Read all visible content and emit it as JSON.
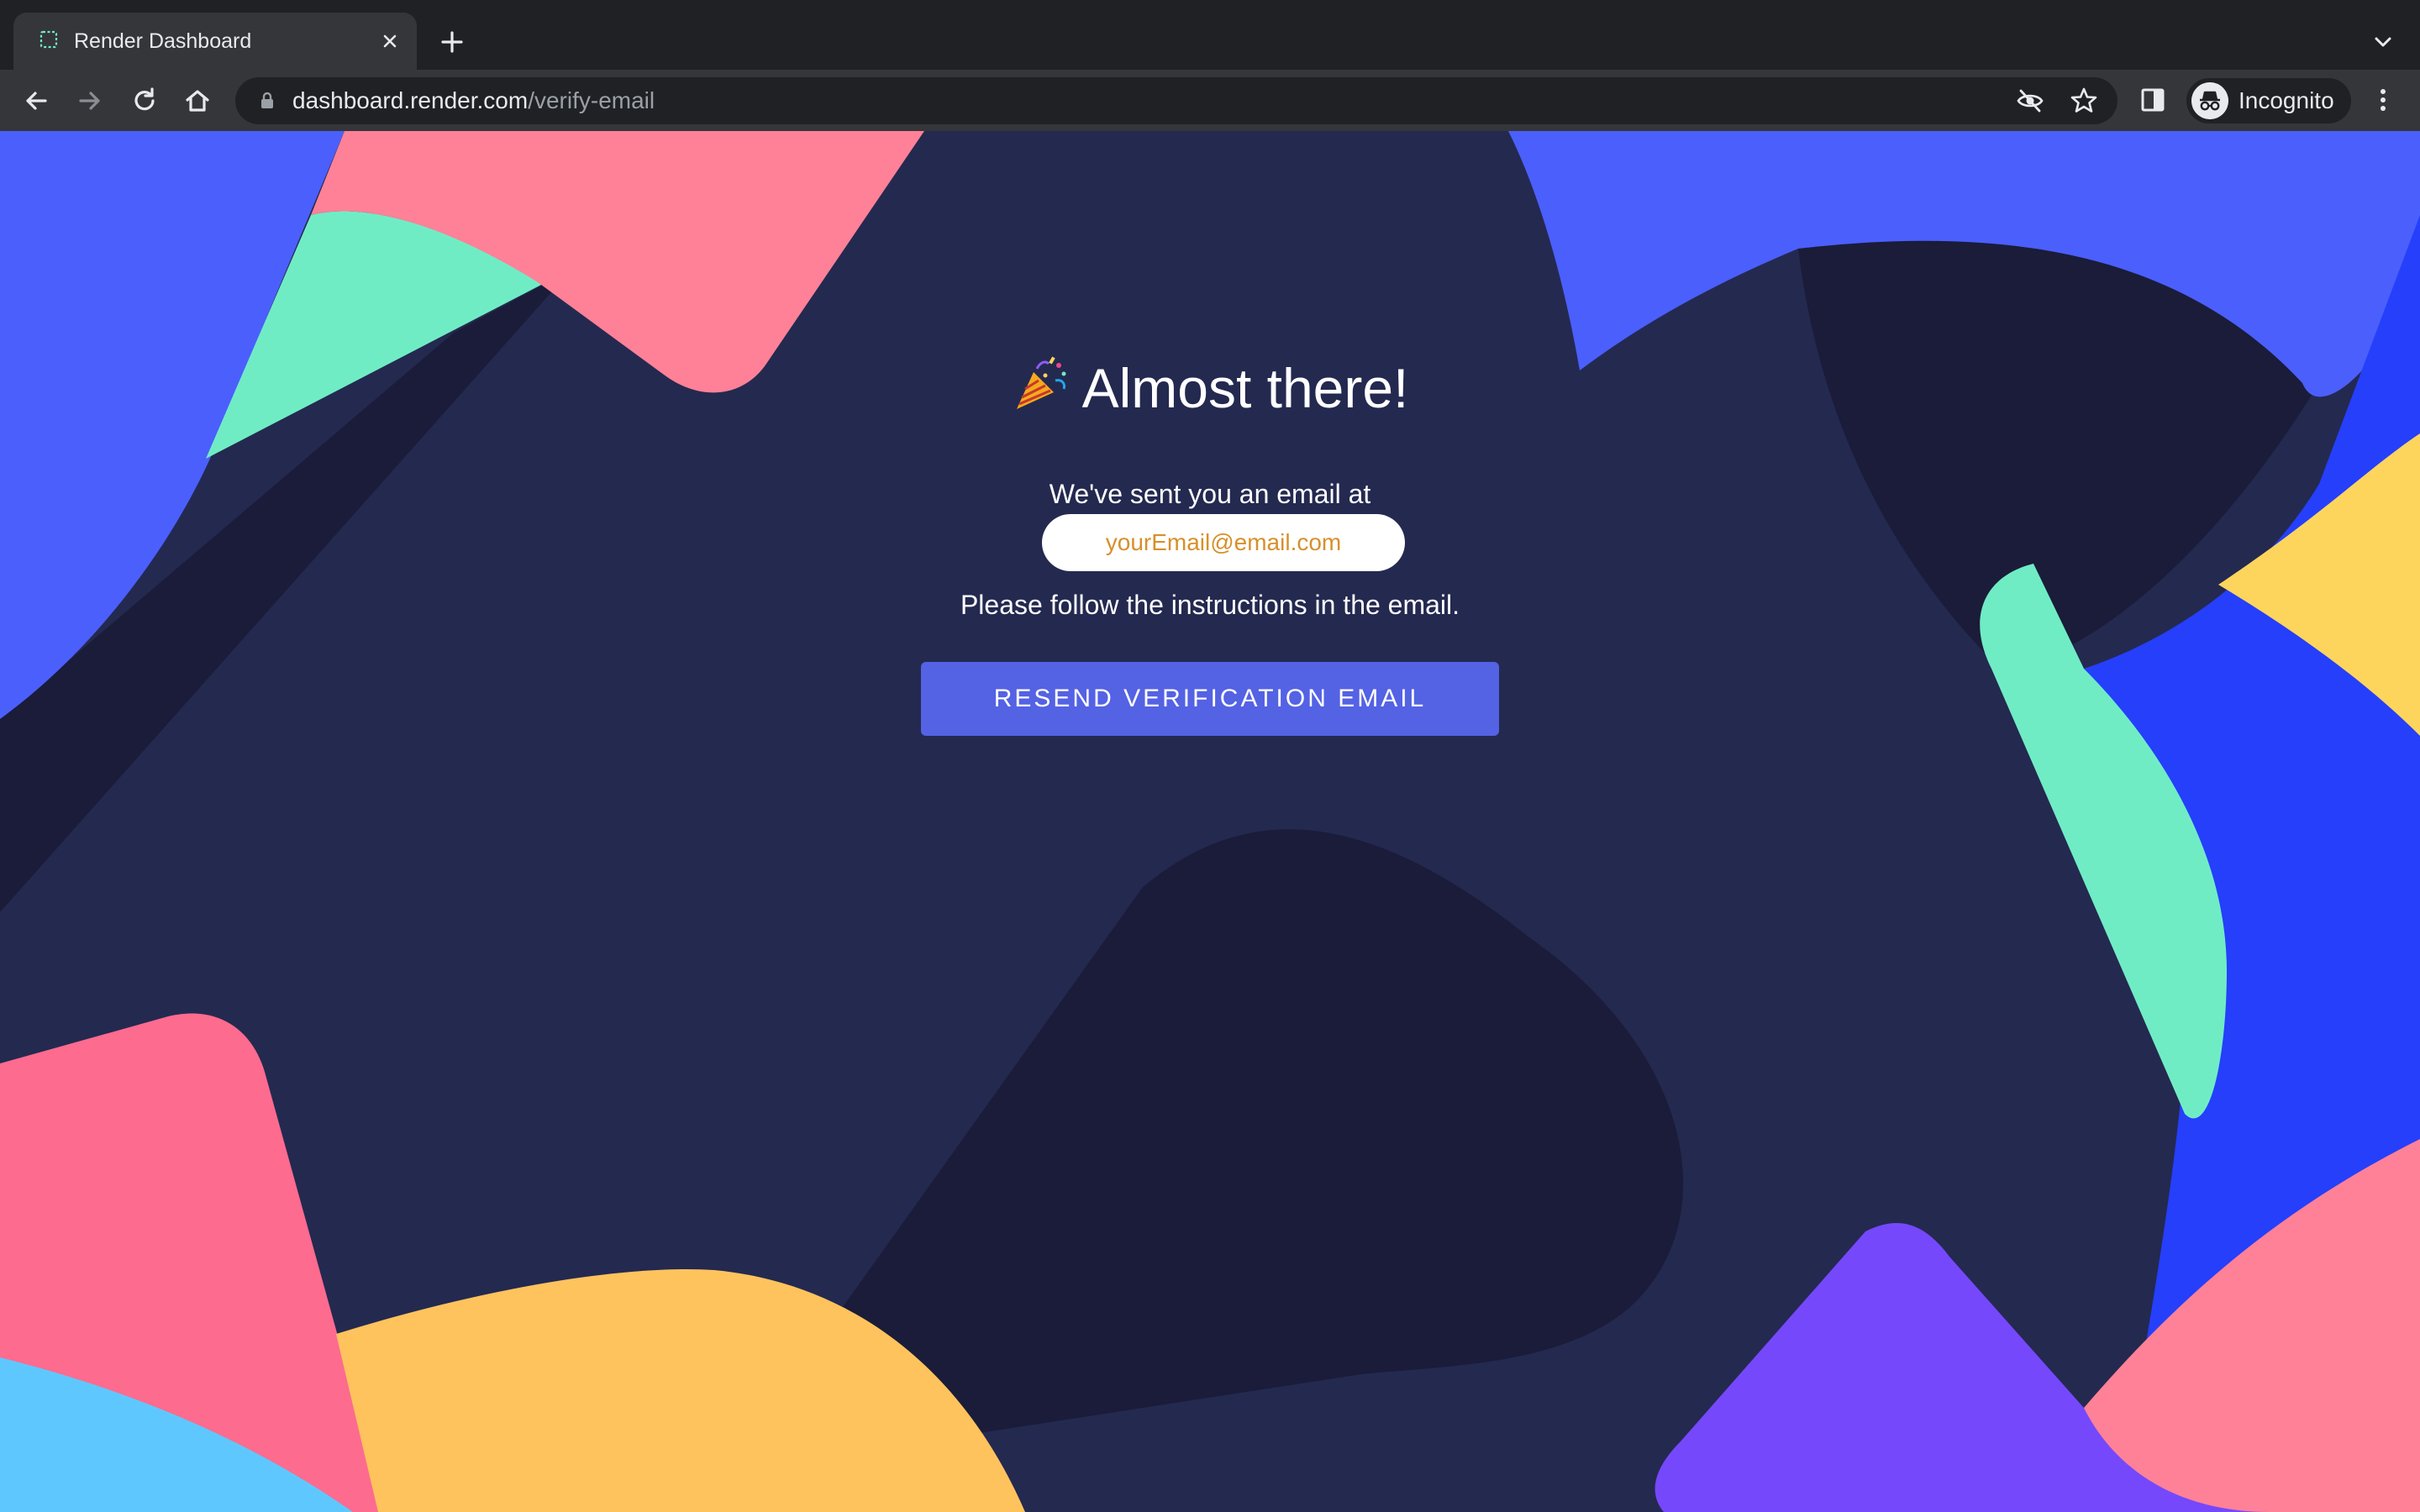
{
  "browser": {
    "tab_title": "Render Dashboard",
    "url_host": "dashboard.render.com",
    "url_path": "/verify-email",
    "profile_label": "Incognito"
  },
  "page": {
    "heading": "Almost there!",
    "sent_text": "We've sent you an email at",
    "email": "yourEmail@email.com",
    "instructions": "Please follow the instructions in the email.",
    "resend_label": "RESEND VERIFICATION EMAIL"
  },
  "colors": {
    "background": "#242950",
    "button": "#5462e4",
    "email_text": "#d7902b",
    "blue": "#4b5ffc",
    "pink": "#fe8197",
    "green": "#70ecc5",
    "yellow": "#fec35d",
    "purple": "#7548fc"
  },
  "icons": [
    "favicon-icon",
    "close-icon",
    "plus-icon",
    "chevron-down-icon",
    "back-icon",
    "forward-icon",
    "reload-icon",
    "home-icon",
    "lock-icon",
    "eye-off-icon",
    "star-icon",
    "side-panel-icon",
    "incognito-icon",
    "kebab-menu-icon",
    "party-popper-icon"
  ]
}
